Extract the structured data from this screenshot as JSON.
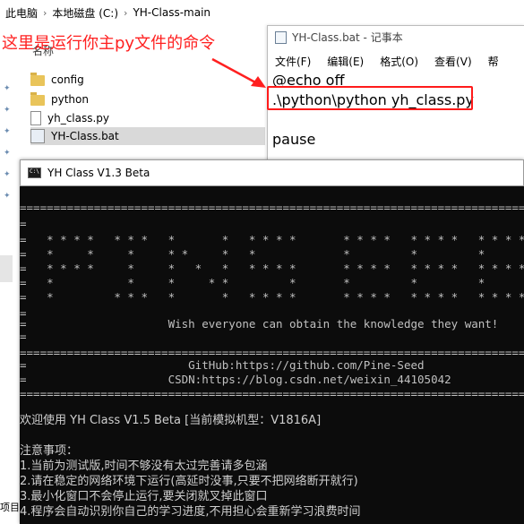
{
  "explorer": {
    "breadcrumb": [
      "此电脑",
      "本地磁盘 (C:)",
      "YH-Class-main"
    ],
    "column_header": "名称",
    "files": [
      {
        "name": "config",
        "type": "folder"
      },
      {
        "name": "python",
        "type": "folder"
      },
      {
        "name": "yh_class.py",
        "type": "file"
      },
      {
        "name": "YH-Class.bat",
        "type": "bat"
      }
    ],
    "side_label": "项目"
  },
  "annotation": {
    "text": "这里是运行你主py文件的命令",
    "color": "#ff2020"
  },
  "notepad": {
    "title": "YH-Class.bat - 记事本",
    "menu": [
      "文件(F)",
      "编辑(E)",
      "格式(O)",
      "查看(V)",
      "帮"
    ],
    "lines": [
      "@echo off",
      ".\\python\\python yh_class.py",
      "",
      "pause"
    ]
  },
  "console": {
    "title": "YH Class V1.3 Beta",
    "lines": [
      "==============================================================================",
      "=",
      "=   * * * *   * * *   *       *   * * * *       * * * *   * * * *   * * * *",
      "=   *     *     *     * *     *   *             *         *         *",
      "=   * * * *     *     *   *   *   * * * *       * * * *   * * * *   * * * *",
      "=   *           *     *     * *         *       *         *         *",
      "=   *         * * *   *       *   * * * *       * * * *   * * * *   * * * *",
      "=",
      "=                     Wish everyone can obtain the knowledge they want!",
      "=",
      "==============================================================================",
      "=                        GitHub:https://github.com/Pine-Seed",
      "=                     CSDN:https://blog.csdn.net/weixin_44105042",
      "=============================================================================="
    ],
    "welcome": "欢迎使用 YH Class V1.5 Beta  [当前模拟机型：V1816A]",
    "notes_title": "注意事项：",
    "notes": [
      "1.当前为测试版,时间不够没有太过完善请多包涵",
      "2.请在稳定的网络环境下运行(高延时没事,只要不把网络断开就行)",
      "3.最小化窗口不会停止运行,要关闭就叉掉此窗口",
      "4.程序会自动识别你自己的学习进度,不用担心会重新学习浪费时间"
    ]
  }
}
